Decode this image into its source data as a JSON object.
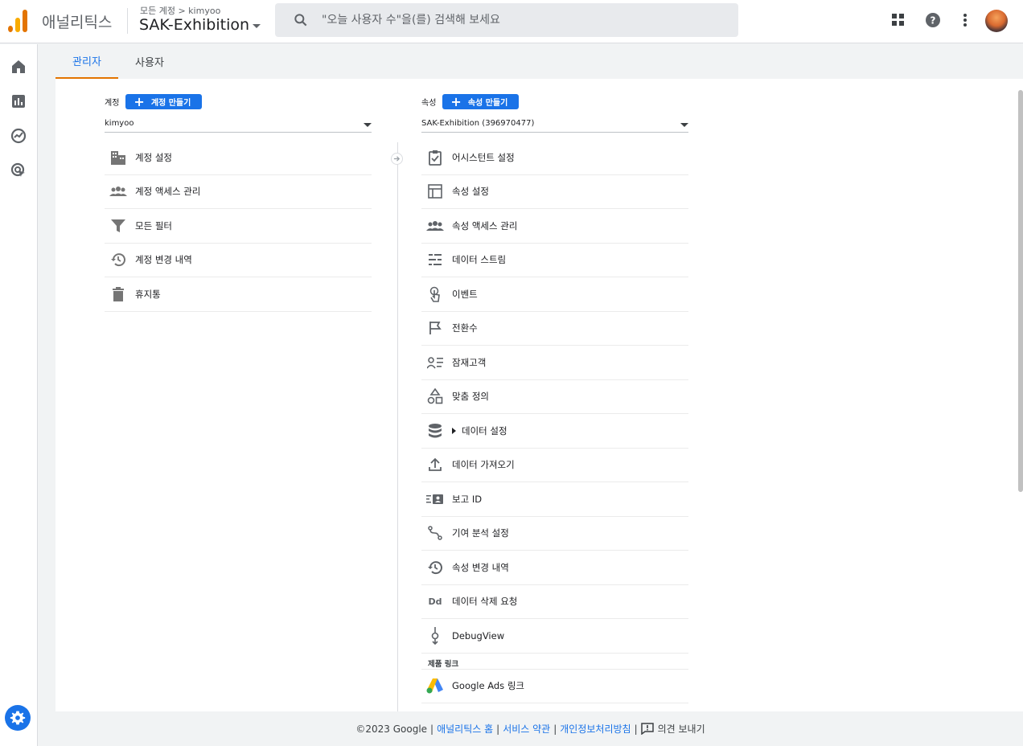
{
  "header": {
    "app_name": "애널리틱스",
    "breadcrumb": "모든 계정 > kimyoo",
    "property_name": "SAK-Exhibition",
    "search_placeholder": "\"오늘 사용자 수\"을(를) 검색해 보세요"
  },
  "tabs": [
    {
      "label": "관리자",
      "active": true
    },
    {
      "label": "사용자",
      "active": false
    }
  ],
  "account": {
    "label": "계정",
    "create_label": "계정 만들기",
    "selected": "kimyoo",
    "items": [
      {
        "label": "계정 설정",
        "icon": "building-icon"
      },
      {
        "label": "계정 액세스 관리",
        "icon": "people-icon"
      },
      {
        "label": "모든 필터",
        "icon": "filter-icon"
      },
      {
        "label": "계정 변경 내역",
        "icon": "history-icon"
      },
      {
        "label": "휴지통",
        "icon": "trash-icon"
      }
    ]
  },
  "property": {
    "label": "속성",
    "create_label": "속성 만들기",
    "selected": "SAK-Exhibition (396970477)",
    "items": [
      {
        "label": "어시스턴트 설정",
        "icon": "clipboard-check-icon"
      },
      {
        "label": "속성 설정",
        "icon": "layout-icon"
      },
      {
        "label": "속성 액세스 관리",
        "icon": "people-icon"
      },
      {
        "label": "데이터 스트림",
        "icon": "stream-icon"
      },
      {
        "label": "이벤트",
        "icon": "touch-icon"
      },
      {
        "label": "전환수",
        "icon": "flag-icon"
      },
      {
        "label": "잠재고객",
        "icon": "audience-icon"
      },
      {
        "label": "맞춤 정의",
        "icon": "shapes-icon"
      },
      {
        "label": "데이터 설정",
        "icon": "database-icon"
      },
      {
        "label": "데이터 가져오기",
        "icon": "upload-icon"
      },
      {
        "label": "보고 ID",
        "icon": "id-card-icon"
      },
      {
        "label": "기여 분석 설정",
        "icon": "route-icon"
      },
      {
        "label": "속성 변경 내역",
        "icon": "history-icon"
      },
      {
        "label": "데이터 삭제 요청",
        "icon": "dd-icon"
      },
      {
        "label": "DebugView",
        "icon": "debug-icon"
      }
    ],
    "product_links_label": "제품 링크",
    "product_links": [
      {
        "label": "Google Ads 링크",
        "icon": "google-ads-icon"
      }
    ]
  },
  "footer": {
    "copyright": "©2023 Google",
    "sep": "|",
    "links": [
      "애널리틱스 홈",
      "서비스 약관",
      "개인정보처리방침"
    ],
    "feedback": "의견 보내기"
  },
  "colors": {
    "accent": "#1a73e8",
    "brand_orange": "#e37400",
    "brand_yellow": "#f9ab00"
  }
}
